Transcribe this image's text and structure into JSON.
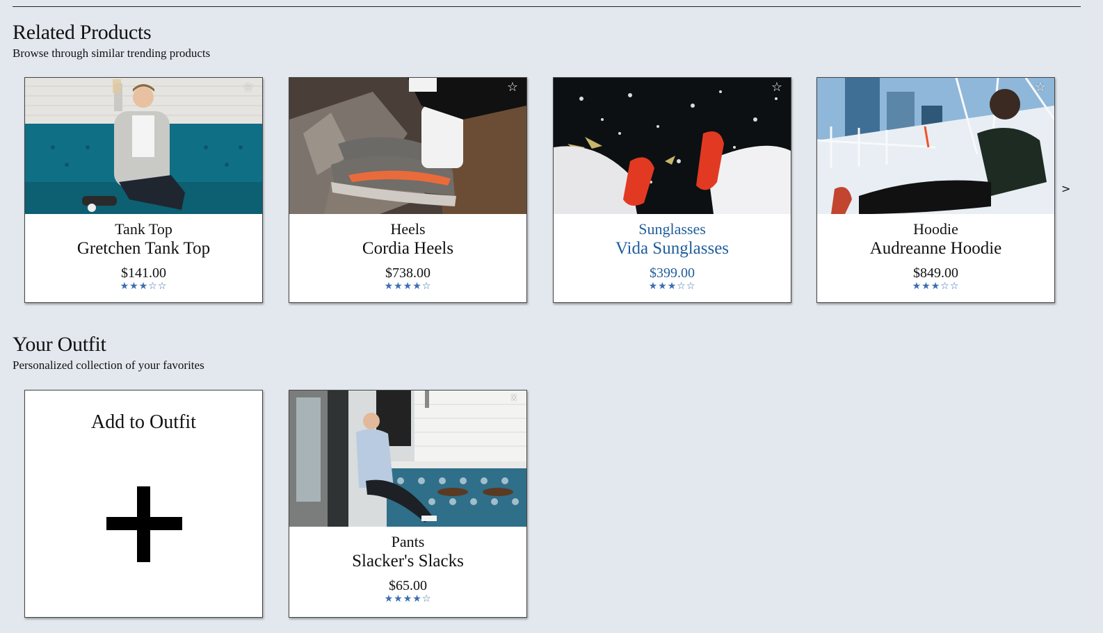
{
  "related": {
    "title": "Related Products",
    "subtitle": "Browse through similar trending products",
    "next_arrow": ">",
    "products": [
      {
        "category": "Tank Top",
        "name": "Gretchen Tank Top",
        "price": "$141.00",
        "rating": 3,
        "stars": "★★★☆☆",
        "action_icon": "☆"
      },
      {
        "category": "Heels",
        "name": "Cordia Heels",
        "price": "$738.00",
        "rating": 4,
        "stars": "★★★★☆",
        "action_icon": "☆"
      },
      {
        "category": "Sunglasses",
        "name": "Vida Sunglasses",
        "price": "$399.00",
        "rating": 3,
        "stars": "★★★☆☆",
        "action_icon": "☆"
      },
      {
        "category": "Hoodie",
        "name": "Audreanne Hoodie",
        "price": "$849.00",
        "rating": 3,
        "stars": "★★★☆☆",
        "action_icon": "☆"
      }
    ]
  },
  "outfit": {
    "title": "Your Outfit",
    "subtitle": "Personalized collection of your favorites",
    "add_label": "Add to Outfit",
    "items": [
      {
        "category": "Pants",
        "name": "Slacker's Slacks",
        "price": "$65.00",
        "rating": 4,
        "stars": "★★★★☆",
        "remove_icon": "x"
      }
    ]
  },
  "colors": {
    "background": "#e3e8ee",
    "highlight_text": "#1f5d9c",
    "star_fill": "#3b6eb0"
  }
}
